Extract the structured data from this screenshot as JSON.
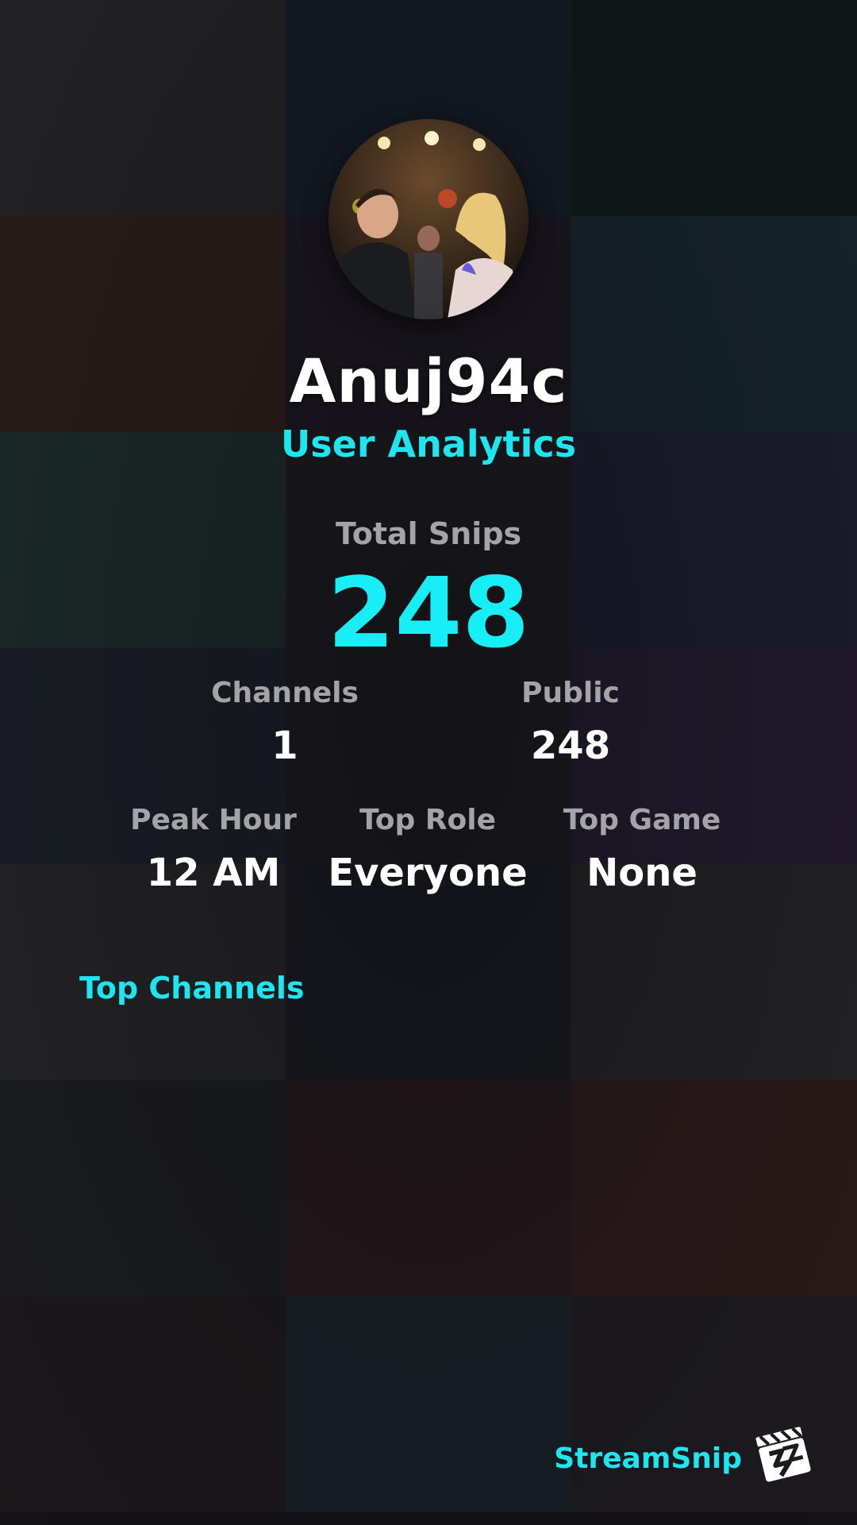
{
  "profile": {
    "username": "Anuj94c",
    "subtitle": "User Analytics",
    "avatar_icon": "profile-photo"
  },
  "stats": {
    "total_label": "Total Snips",
    "total_value": "248",
    "channels_label": "Channels",
    "channels_value": "1",
    "public_label": "Public",
    "public_value": "248",
    "peak_hour_label": "Peak Hour",
    "peak_hour_value": "12 AM",
    "top_role_label": "Top Role",
    "top_role_value": "Everyone",
    "top_game_label": "Top Game",
    "top_game_value": "None"
  },
  "sections": {
    "top_channels_label": "Top Channels"
  },
  "footer": {
    "brand": "StreamSnip",
    "logo_icon": "clapperboard-logo-icon"
  },
  "colors": {
    "accent": "#1ee6f0",
    "label": "#a3a3a8",
    "value": "#ffffff"
  }
}
